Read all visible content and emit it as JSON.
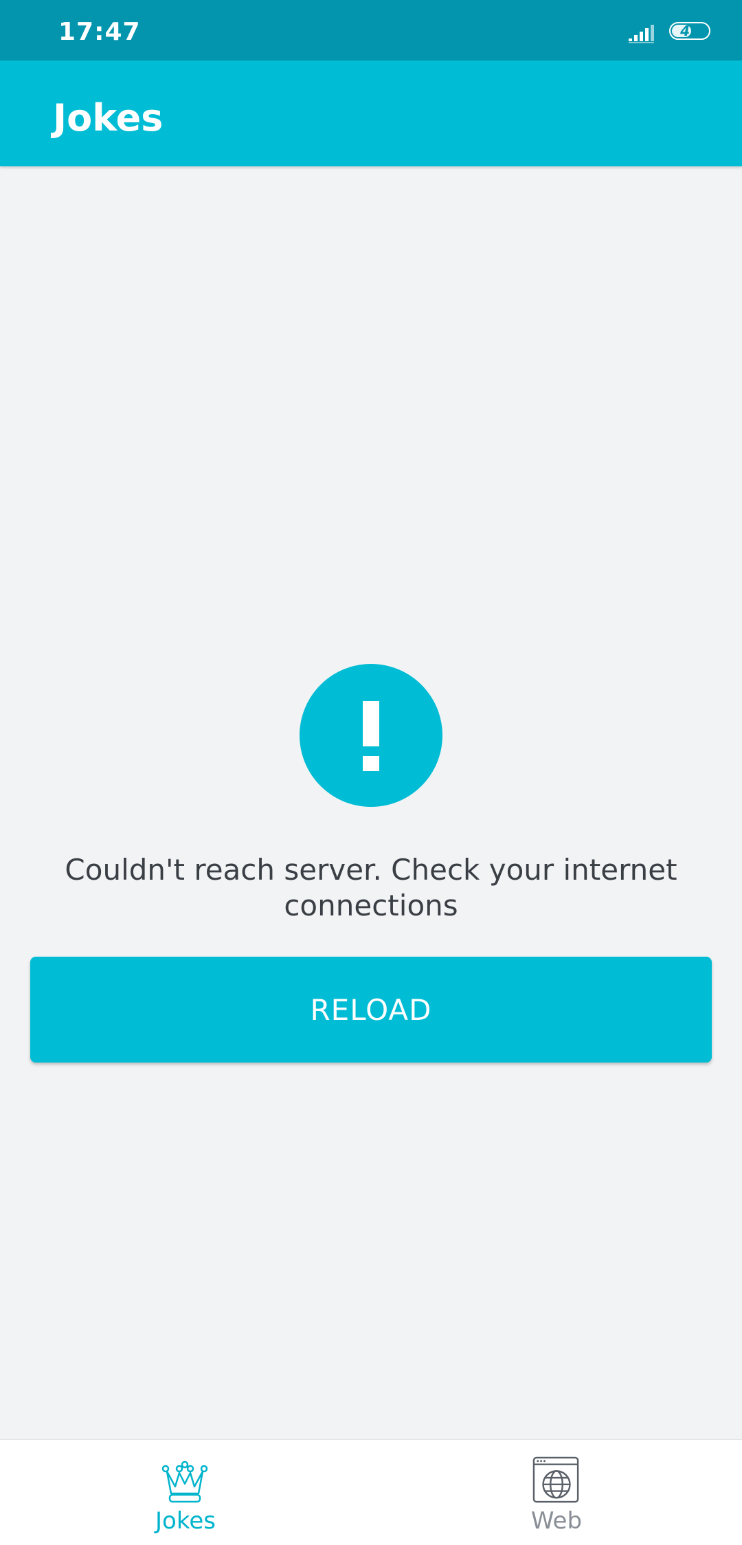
{
  "status_bar": {
    "time": "17:47",
    "battery_level": "47",
    "signal_icon": "signal-icon",
    "battery_icon": "battery-icon"
  },
  "app_bar": {
    "title": "Jokes"
  },
  "error": {
    "icon": "exclamation-icon",
    "message": "Couldn't reach server. Check your internet connections",
    "reload_label": "RELOAD"
  },
  "bottom_nav": {
    "items": [
      {
        "label": "Jokes",
        "icon": "crown-icon",
        "active": true
      },
      {
        "label": "Web",
        "icon": "globe-browser-icon",
        "active": false
      }
    ]
  },
  "colors": {
    "status_bar": "#0395ad",
    "primary": "#00bcd4",
    "background": "#f2f3f5",
    "text": "#3a3f45",
    "nav_active": "#00b4cc",
    "nav_inactive": "#8a8f96"
  }
}
